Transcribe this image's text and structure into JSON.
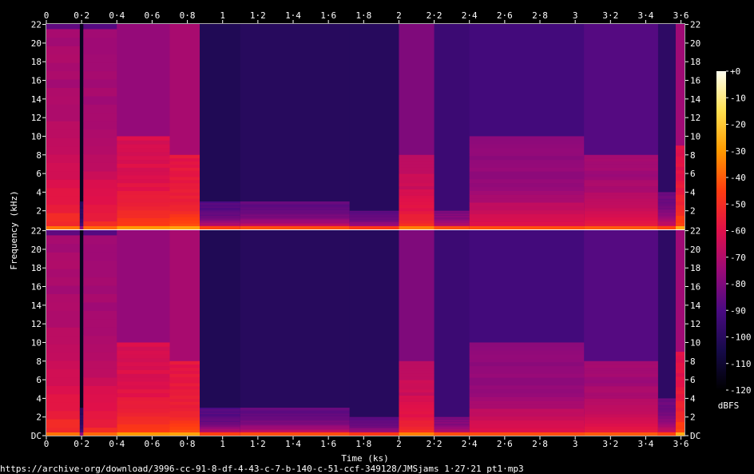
{
  "chart_data": {
    "type": "heatmap",
    "title": "",
    "xlabel": "Time (ks)",
    "ylabel": "Frequency (kHz)",
    "xlim": [
      0,
      3.62
    ],
    "ylim": [
      0,
      22.05
    ],
    "x_ticks": [
      "0",
      "0·2",
      "0·4",
      "0·6",
      "0·8",
      "1",
      "1·2",
      "1·4",
      "1·6",
      "1·8",
      "2",
      "2·2",
      "2·4",
      "2·6",
      "2·8",
      "3",
      "3·2",
      "3·4",
      "3·6"
    ],
    "y_ticks_top": [
      "22",
      "20",
      "18",
      "16",
      "14",
      "12",
      "10",
      "8",
      "6",
      "4",
      "2"
    ],
    "y_ticks_bottom": [
      "22",
      "20",
      "18",
      "16",
      "14",
      "12",
      "10",
      "8",
      "6",
      "4",
      "2",
      "DC"
    ],
    "colorbar": {
      "label": "dBFS",
      "range": [
        -120,
        0
      ],
      "ticks": [
        "+0",
        "-10",
        "-20",
        "-30",
        "-40",
        "-50",
        "-60",
        "-70",
        "-80",
        "-90",
        "-100",
        "-110",
        "-120"
      ],
      "colors": [
        "#fffff0",
        "#ffe050",
        "#ff9a00",
        "#ff3c10",
        "#e0104a",
        "#9a0a78",
        "#4a0a82",
        "#160a4a",
        "#000000"
      ]
    },
    "channels": 2,
    "segments": [
      {
        "start": 0.0,
        "end": 0.19,
        "level": -72,
        "ceiling": 21.5,
        "low_boost": 22
      },
      {
        "start": 0.19,
        "end": 0.21,
        "level": -100,
        "ceiling": 3,
        "low_boost": 10
      },
      {
        "start": 0.21,
        "end": 0.4,
        "level": -74,
        "ceiling": 21.5,
        "low_boost": 22
      },
      {
        "start": 0.4,
        "end": 0.7,
        "level": -62,
        "ceiling": 10,
        "low_boost": 18
      },
      {
        "start": 0.7,
        "end": 0.87,
        "level": -58,
        "ceiling": 8,
        "low_boost": 16
      },
      {
        "start": 0.87,
        "end": 1.1,
        "level": -88,
        "ceiling": 3,
        "low_boost": 30
      },
      {
        "start": 1.1,
        "end": 1.72,
        "level": -86,
        "ceiling": 3,
        "low_boost": 30
      },
      {
        "start": 1.72,
        "end": 2.0,
        "level": -86,
        "ceiling": 2,
        "low_boost": 26
      },
      {
        "start": 2.0,
        "end": 2.2,
        "level": -66,
        "ceiling": 8,
        "low_boost": 18
      },
      {
        "start": 2.2,
        "end": 2.4,
        "level": -80,
        "ceiling": 2,
        "low_boost": 24
      },
      {
        "start": 2.4,
        "end": 3.05,
        "level": -78,
        "ceiling": 10,
        "low_boost": 22
      },
      {
        "start": 3.05,
        "end": 3.47,
        "level": -74,
        "ceiling": 8,
        "low_boost": 20
      },
      {
        "start": 3.47,
        "end": 3.57,
        "level": -84,
        "ceiling": 4,
        "low_boost": 26
      },
      {
        "start": 3.57,
        "end": 3.62,
        "level": -60,
        "ceiling": 9,
        "low_boost": 20
      }
    ]
  },
  "footer": {
    "source_url": "https://archive·org/download/3996-cc-91-8-df-4-43-c-7-b-140-c-51-ccf-349128/JMSjams 1·27·21 pt1·mp3"
  }
}
